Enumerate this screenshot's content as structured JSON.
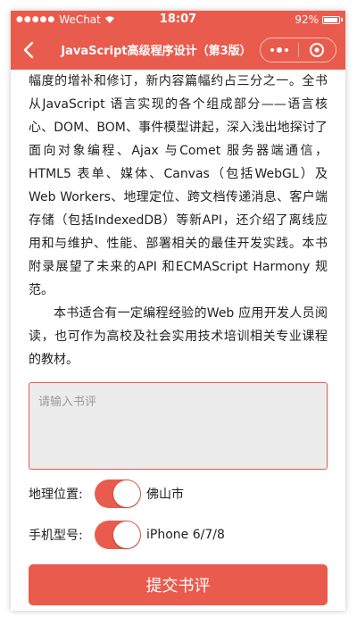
{
  "status_bar": {
    "carrier": "WeChat",
    "time": "18:07",
    "battery": "92%"
  },
  "nav": {
    "title": "JavaScript高级程序设计（第3版）"
  },
  "description": {
    "paragraph1": "幅度的增补和修订，新内容篇幅约占三分之一。全书从JavaScript 语言实现的各个组成部分——语言核心、DOM、BOM、事件模型讲起，深入浅出地探讨了面向对象编程、Ajax 与Comet 服务器端通信，HTML5 表单、媒体、Canvas（包括WebGL）及Web Workers、地理定位、跨文档传递消息、客户端存储（包括IndexedDB）等新API，还介绍了离线应用和与维护、性能、部署相关的最佳开发实践。本书附录展望了未来的API 和ECMAScript Harmony 规范。",
    "paragraph2": "本书适合有一定编程经验的Web 应用开发人员阅读，也可作为高校及社会实用技术培训相关专业课程的教材。"
  },
  "review": {
    "placeholder": "请输入书评",
    "value": ""
  },
  "location": {
    "label": "地理位置:",
    "enabled": true,
    "value": "佛山市"
  },
  "device": {
    "label": "手机型号:",
    "enabled": true,
    "value": "iPhone 6/7/8"
  },
  "submit": {
    "label": "提交书评"
  },
  "colors": {
    "accent": "#e95b4d"
  }
}
